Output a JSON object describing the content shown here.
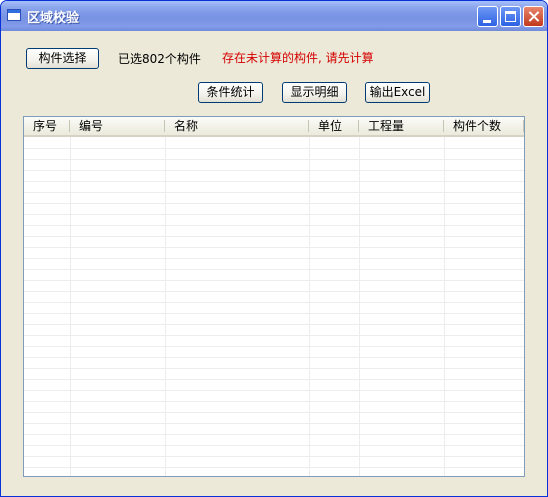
{
  "window": {
    "title": "区域校验"
  },
  "toolbar": {
    "select_label": "构件选择",
    "selected_count_text": "已选802个构件",
    "warning_text": "存在未计算的构件, 请先计算",
    "warning_color": "#d40000",
    "stats_label": "条件统计",
    "detail_label": "显示明细",
    "excel_label": "输出Excel"
  },
  "table": {
    "columns": [
      "序号",
      "编号",
      "名称",
      "单位",
      "工程量",
      "构件个数"
    ],
    "rows": []
  },
  "colors": {
    "titlebar": "#7893e2",
    "window_bg": "#ece9d8",
    "close_button": "#c2391c"
  }
}
